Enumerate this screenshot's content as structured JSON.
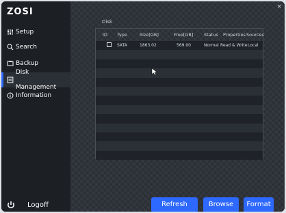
{
  "brand": {
    "logo_text": "ZOSI"
  },
  "sidebar": {
    "items": [
      {
        "label": "Setup",
        "icon": "sliders-icon",
        "active": false
      },
      {
        "label": "Search",
        "icon": "search-icon",
        "active": false
      },
      {
        "label": "Backup",
        "icon": "backup-icon",
        "active": false
      },
      {
        "label": "Disk Management",
        "icon": "disk-icon",
        "active": true
      },
      {
        "label": "Information",
        "icon": "info-icon",
        "active": false
      }
    ],
    "logoff_label": "Logoff"
  },
  "main": {
    "close_glyph": "×",
    "section_title": "Disk",
    "table": {
      "headers": [
        "ID",
        "Type",
        "Size[GB]",
        "Free[GB]",
        "Status",
        "Properties",
        "Sources"
      ],
      "rows": [
        {
          "id": "",
          "type": "SATA",
          "size": "1863.02",
          "free": "569.00",
          "status": "Normal",
          "properties": "Read & Write",
          "source": "Local"
        }
      ],
      "empty_rows": 12
    }
  },
  "footer": {
    "refresh_label": "Refresh",
    "browse_label": "Browse",
    "format_label": "Format"
  },
  "colors": {
    "accent": "#2d68ff",
    "sidebar_bg": "#1c1f24",
    "main_bg": "#2b2f36",
    "row_dark": "#1f2329"
  }
}
